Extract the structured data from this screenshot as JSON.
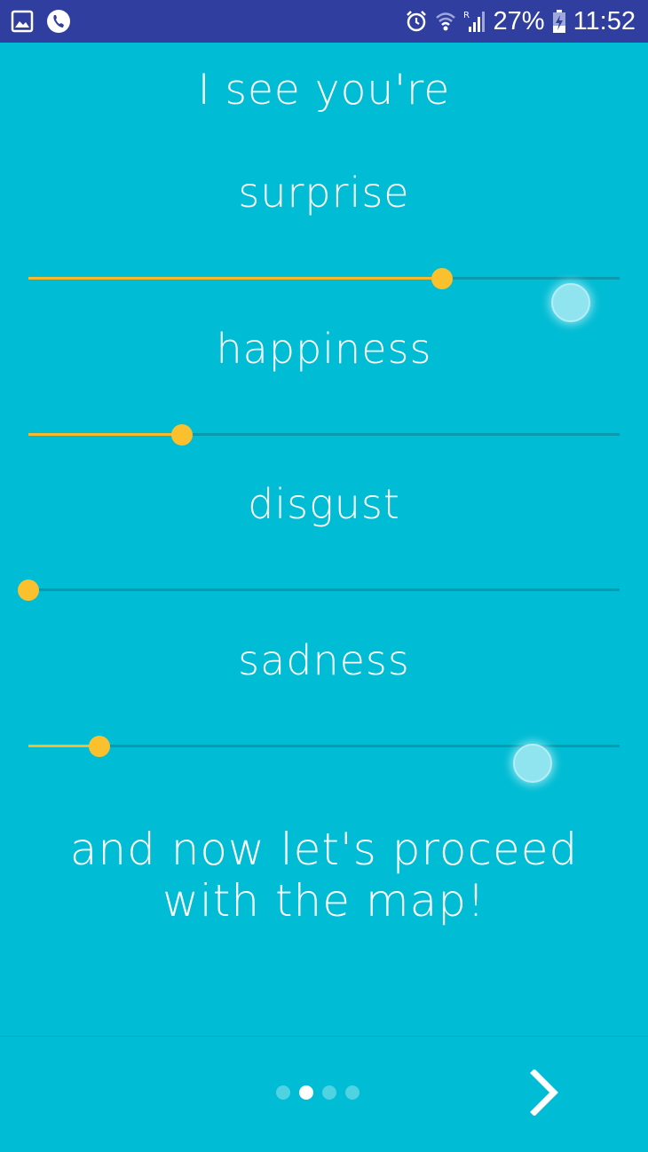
{
  "status_bar": {
    "battery": "27%",
    "time": "11:52",
    "icons": [
      "gallery-icon",
      "phone-call-icon",
      "alarm-icon",
      "wifi-icon",
      "signal-icon",
      "battery-charging-icon"
    ]
  },
  "title": "I see you're",
  "emotions": [
    {
      "label": "surprise",
      "value": 0.7
    },
    {
      "label": "happiness",
      "value": 0.26
    },
    {
      "label": "disgust",
      "value": 0.0
    },
    {
      "label": "sadness",
      "value": 0.12
    }
  ],
  "closing_line_1": "and now let's proceed",
  "closing_line_2": "with the map!",
  "pager": {
    "total": 4,
    "active_index": 1
  },
  "next_icon": "chevron-right-icon",
  "colors": {
    "background": "#00bcd4",
    "status_bar": "#303f9f",
    "slider_accent": "#fbc02d",
    "track": "#0a9aae"
  }
}
